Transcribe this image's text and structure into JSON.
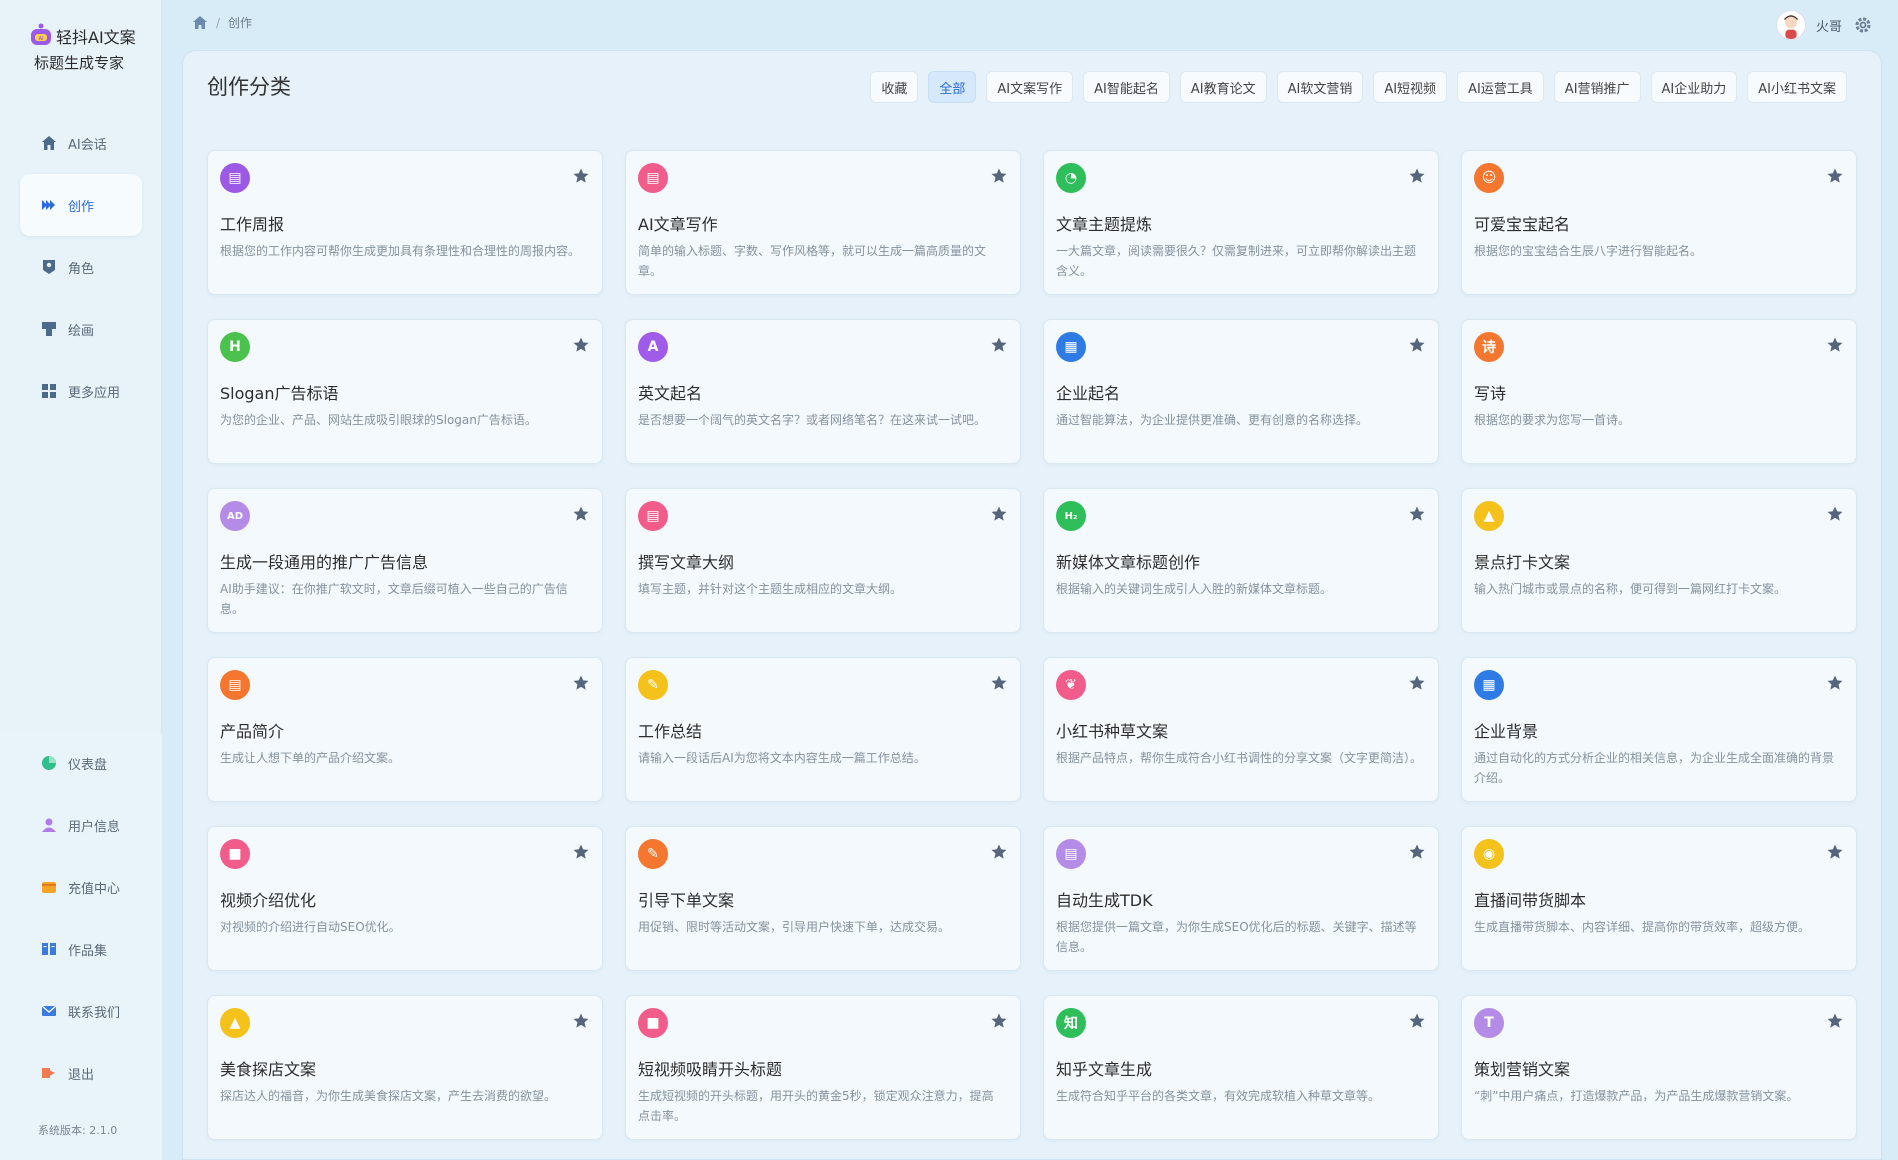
{
  "app": {
    "title": "轻抖AI文案",
    "subtitle": "标题生成专家",
    "version": "系统版本: 2.1.0"
  },
  "breadcrumb": {
    "current": "创作"
  },
  "user": {
    "name": "火哥"
  },
  "nav": {
    "top": [
      {
        "label": "AI会话",
        "icon": "home-icon"
      },
      {
        "label": "创作",
        "icon": "create-icon",
        "active": true
      },
      {
        "label": "角色",
        "icon": "role-icon"
      },
      {
        "label": "绘画",
        "icon": "paint-icon"
      },
      {
        "label": "更多应用",
        "icon": "apps-icon"
      }
    ],
    "bottom": [
      {
        "label": "仪表盘",
        "icon": "dashboard-icon"
      },
      {
        "label": "用户信息",
        "icon": "user-icon"
      },
      {
        "label": "充值中心",
        "icon": "wallet-icon"
      },
      {
        "label": "作品集",
        "icon": "book-icon"
      },
      {
        "label": "联系我们",
        "icon": "mail-icon"
      },
      {
        "label": "退出",
        "icon": "logout-icon"
      }
    ]
  },
  "panel": {
    "title": "创作分类"
  },
  "filters": [
    {
      "label": "收藏"
    },
    {
      "label": "全部",
      "active": true
    },
    {
      "label": "AI文案写作"
    },
    {
      "label": "AI智能起名"
    },
    {
      "label": "AI教育论文"
    },
    {
      "label": "AI软文营销"
    },
    {
      "label": "AI短视频"
    },
    {
      "label": "AI运营工具"
    },
    {
      "label": "AI营销推广"
    },
    {
      "label": "AI企业助力"
    },
    {
      "label": "AI小红书文案"
    }
  ],
  "cards": [
    {
      "title": "工作周报",
      "desc": "根据您的工作内容可帮你生成更加具有条理性和合理性的周报内容。",
      "icon": "report-icon",
      "color": "#9b59e6",
      "glyph": "▤"
    },
    {
      "title": "AI文章写作",
      "desc": "简单的输入标题、字数、写作风格等，就可以生成一篇高质量的文章。",
      "icon": "article-icon",
      "color": "#f25c8a",
      "glyph": "▤"
    },
    {
      "title": "文章主题提炼",
      "desc": "一大篇文章，阅读需要很久？仅需复制进来，可立即帮你解读出主题含义。",
      "icon": "extract-icon",
      "color": "#2fbf5a",
      "glyph": "◔"
    },
    {
      "title": "可爱宝宝起名",
      "desc": "根据您的宝宝结合生辰八字进行智能起名。",
      "icon": "baby-icon",
      "color": "#f5762e",
      "glyph": "☺"
    },
    {
      "title": "Slogan广告标语",
      "desc": "为您的企业、产品、网站生成吸引眼球的Slogan广告标语。",
      "icon": "slogan-icon",
      "color": "#4cc24e",
      "glyph": "H"
    },
    {
      "title": "英文起名",
      "desc": "是否想要一个阔气的英文名字？或者网络笔名？在这来试一试吧。",
      "icon": "english-icon",
      "color": "#a05be8",
      "glyph": "A"
    },
    {
      "title": "企业起名",
      "desc": "通过智能算法，为企业提供更准确、更有创意的名称选择。",
      "icon": "company-icon",
      "color": "#2f7be5",
      "glyph": "▦"
    },
    {
      "title": "写诗",
      "desc": "根据您的要求为您写一首诗。",
      "icon": "poem-icon",
      "color": "#f5762e",
      "glyph": "诗"
    },
    {
      "title": "生成一段通用的推广广告信息",
      "desc": "AI助手建议：在你推广软文时，文章后缀可植入一些自己的广告信息。",
      "icon": "ad-icon",
      "color": "#b58be8",
      "glyph": "AD"
    },
    {
      "title": "撰写文章大纲",
      "desc": "填写主题，并针对这个主题生成相应的文章大纲。",
      "icon": "outline-icon",
      "color": "#f25c8a",
      "glyph": "▤"
    },
    {
      "title": "新媒体文章标题创作",
      "desc": "根据输入的关键词生成引人入胜的新媒体文章标题。",
      "icon": "heading-icon",
      "color": "#2fbf5a",
      "glyph": "H₂"
    },
    {
      "title": "景点打卡文案",
      "desc": "输入热门城市或景点的名称，便可得到一篇网红打卡文案。",
      "icon": "landmark-icon",
      "color": "#f5c21c",
      "glyph": "▲"
    },
    {
      "title": "产品简介",
      "desc": "生成让人想下单的产品介绍文案。",
      "icon": "product-icon",
      "color": "#f5762e",
      "glyph": "▤"
    },
    {
      "title": "工作总结",
      "desc": "请输入一段话后AI为您将文本内容生成一篇工作总结。",
      "icon": "summary-icon",
      "color": "#f5c21c",
      "glyph": "✎"
    },
    {
      "title": "小红书种草文案",
      "desc": "根据产品特点，帮你生成符合小红书调性的分享文案（文字更简洁）。",
      "icon": "sprout-icon",
      "color": "#f25c8a",
      "glyph": "❦"
    },
    {
      "title": "企业背景",
      "desc": "通过自动化的方式分析企业的相关信息，为企业生成全面准确的背景介绍。",
      "icon": "building-icon",
      "color": "#2f7be5",
      "glyph": "▦"
    },
    {
      "title": "视频介绍优化",
      "desc": "对视频的介绍进行自动SEO优化。",
      "icon": "video-icon",
      "color": "#f25c8a",
      "glyph": "■"
    },
    {
      "title": "引导下单文案",
      "desc": "用促销、限时等活动文案，引导用户快速下单，达成交易。",
      "icon": "order-icon",
      "color": "#f5762e",
      "glyph": "✎"
    },
    {
      "title": "自动生成TDK",
      "desc": "根据您提供一篇文章，为你生成SEO优化后的标题、关键字、描述等信息。",
      "icon": "tdk-icon",
      "color": "#b58be8",
      "glyph": "▤"
    },
    {
      "title": "直播间带货脚本",
      "desc": "生成直播带货脚本、内容详细、提高你的带货效率，超级方便。",
      "icon": "live-icon",
      "color": "#f5c21c",
      "glyph": "◉"
    },
    {
      "title": "美食探店文案",
      "desc": "探店达人的福音，为你生成美食探店文案，产生去消费的欲望。",
      "icon": "food-icon",
      "color": "#f5c21c",
      "glyph": "▲"
    },
    {
      "title": "短视频吸睛开头标题",
      "desc": "生成短视频的开头标题，用开头的黄金5秒，锁定观众注意力，提高点击率。",
      "icon": "shortvideo-icon",
      "color": "#f25c8a",
      "glyph": "■"
    },
    {
      "title": "知乎文章生成",
      "desc": "生成符合知乎平台的各类文章，有效完成软植入种草文章等。",
      "icon": "zhihu-icon",
      "color": "#2fbf5a",
      "glyph": "知"
    },
    {
      "title": "策划营销文案",
      "desc": "“刺”中用户痛点，打造爆款产品，为产品生成爆款营销文案。",
      "icon": "marketing-icon",
      "color": "#b58be8",
      "glyph": "T"
    }
  ]
}
